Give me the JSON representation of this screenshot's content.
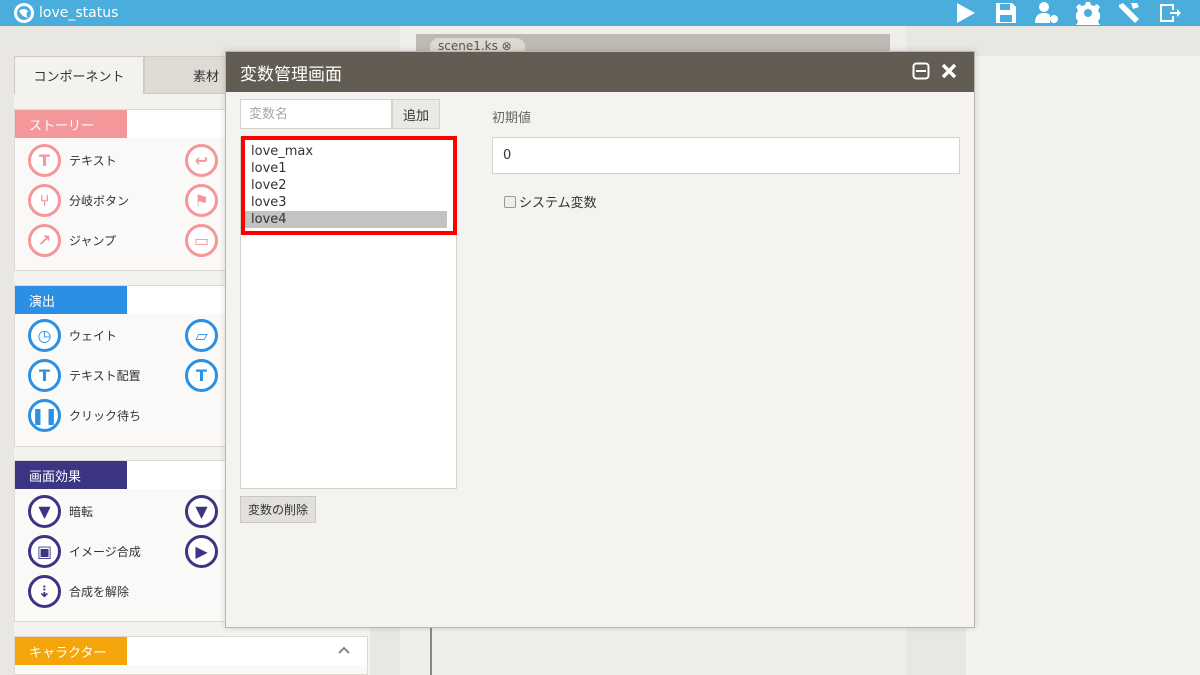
{
  "app": {
    "title": "love_status"
  },
  "toolbar": {
    "icons": [
      "play-icon",
      "save-icon",
      "user-settings-icon",
      "gear-icon",
      "tools-icon",
      "exit-icon"
    ]
  },
  "left_panel": {
    "tabs": [
      {
        "label": "コンポーネント"
      },
      {
        "label": "素材"
      }
    ],
    "categories": [
      {
        "label": "ストーリー",
        "color": "#f4979b",
        "items": [
          {
            "label": "テキスト",
            "icon": "text-T-icon"
          },
          {
            "label": "分岐ボタン",
            "icon": "branch-icon"
          },
          {
            "label": "ジャンプ",
            "icon": "jump-icon"
          }
        ]
      },
      {
        "label": "演出",
        "color": "#2b8fe3",
        "items": [
          {
            "label": "ウェイト",
            "icon": "clock-icon"
          },
          {
            "label": "テキスト配置",
            "icon": "text-position-icon"
          },
          {
            "label": "クリック待ち",
            "icon": "pause-icon"
          }
        ]
      },
      {
        "label": "画面効果",
        "color": "#3b3583",
        "items": [
          {
            "label": "暗転",
            "icon": "fade-icon"
          },
          {
            "label": "イメージ合成",
            "icon": "image-icon"
          },
          {
            "label": "合成を解除",
            "icon": "release-icon"
          }
        ]
      },
      {
        "label": "キャラクター",
        "color": "#f5a50c",
        "items": []
      }
    ]
  },
  "scene_tab": {
    "label": "scene1.ks ⊗"
  },
  "dialog": {
    "title": "変数管理画面",
    "name_placeholder": "変数名",
    "add_label": "追加",
    "variables": [
      "love_max",
      "love1",
      "love2",
      "love3",
      "love4"
    ],
    "selected_index": 4,
    "delete_label": "変数の削除",
    "initial_label": "初期値",
    "initial_value": "0",
    "system_var_label": "システム変数",
    "system_var_checked": false,
    "highlight_color": "#ff0000"
  }
}
